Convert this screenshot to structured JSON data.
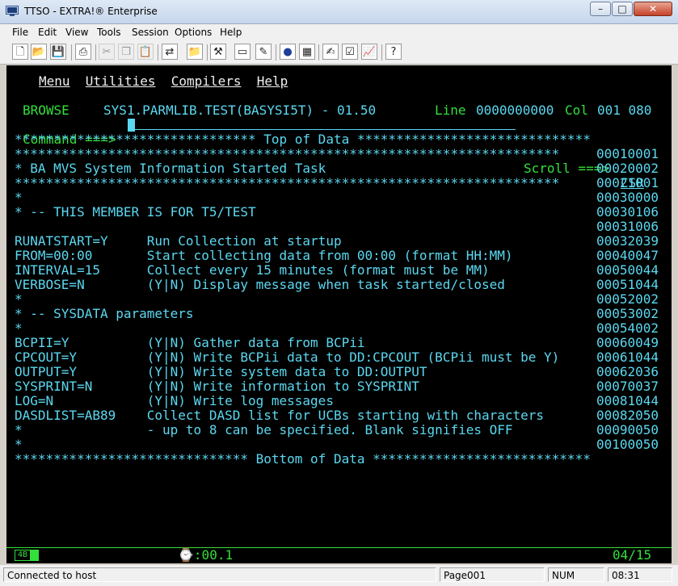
{
  "window": {
    "title": "TTSO - EXTRA!® Enterprise",
    "minimize": "–",
    "maximize": "□",
    "close": "✕"
  },
  "menubar": [
    "File",
    "Edit",
    "View",
    "Tools",
    "Session",
    "Options",
    "Help"
  ],
  "toolbar_icons": [
    "new-icon",
    "open-icon",
    "save-icon",
    "print-icon",
    "cut-icon",
    "copy-icon",
    "paste-icon",
    "transfer-icon",
    "open-folder-icon",
    "tools-icon",
    "disk-icon",
    "edit-icon",
    "dot-icon",
    "macro-icon",
    "notepad-icon",
    "check-icon",
    "graph-icon",
    "help-icon"
  ],
  "terminal": {
    "menu": {
      "item1": "Menu",
      "item2": "Utilities",
      "item3": "Compilers",
      "item4": "Help"
    },
    "header": {
      "mode": "BROWSE",
      "dataset": "SYS1.PARMLIB.TEST(BASYSI5T) - 01.50",
      "line_label": "Line",
      "line_value": "0000000000",
      "col_label": "Col",
      "col_value": "001 080",
      "command_label": "Command ===>",
      "scroll_label": "Scroll ===>",
      "scroll_value": "CSR"
    },
    "top_of_data": "******************************* Top of Data ******************************",
    "bottom_of_data": "****************************** Bottom of Data ****************************",
    "lines": [
      {
        "text": "**********************************************************************",
        "num": "00010001"
      },
      {
        "text": "* BA MVS System Information Started Task",
        "num": "00020002"
      },
      {
        "text": "**********************************************************************",
        "num": "00021001"
      },
      {
        "text": "*",
        "num": "00030000"
      },
      {
        "text": "* -- THIS MEMBER IS FOR T5/TEST",
        "num": "00030106"
      },
      {
        "text": "",
        "num": "00031006"
      },
      {
        "text": "RUNATSTART=Y     Run Collection at startup",
        "num": "00032039"
      },
      {
        "text": "FROM=00:00       Start collecting data from 00:00 (format HH:MM)",
        "num": "00040047"
      },
      {
        "text": "INTERVAL=15      Collect every 15 minutes (format must be MM)",
        "num": "00050044"
      },
      {
        "text": "VERBOSE=N        (Y|N) Display message when task started/closed",
        "num": "00051044"
      },
      {
        "text": "*",
        "num": "00052002"
      },
      {
        "text": "* -- SYSDATA parameters",
        "num": "00053002"
      },
      {
        "text": "*",
        "num": "00054002"
      },
      {
        "text": "BCPII=Y          (Y|N) Gather data from BCPii",
        "num": "00060049"
      },
      {
        "text": "CPCOUT=Y         (Y|N) Write BCPii data to DD:CPCOUT (BCPii must be Y)",
        "num": "00061044"
      },
      {
        "text": "OUTPUT=Y         (Y|N) Write system data to DD:OUTPUT",
        "num": "00062036"
      },
      {
        "text": "SYSPRINT=N       (Y|N) Write information to SYSPRINT",
        "num": "00070037"
      },
      {
        "text": "LOG=N            (Y|N) Write log messages",
        "num": "00081044"
      },
      {
        "text": "DASDLIST=AB89    Collect DASD list for UCBs starting with characters",
        "num": "00082050"
      },
      {
        "text": "*                - up to 8 can be specified. Blank signifies OFF",
        "num": "00090050"
      },
      {
        "text": "*",
        "num": "00100050"
      }
    ],
    "oia": {
      "session": "4B",
      "time": ":00.1",
      "cursor_pos": "04/15"
    }
  },
  "statusbar": {
    "connection": "Connected to host",
    "page": "Page001",
    "num": "NUM",
    "time": "08:31"
  },
  "colors": {
    "terminal_bg": "#000000",
    "cyan": "#5bd8f0",
    "green": "#33e03a",
    "white": "#f0f0f0"
  }
}
